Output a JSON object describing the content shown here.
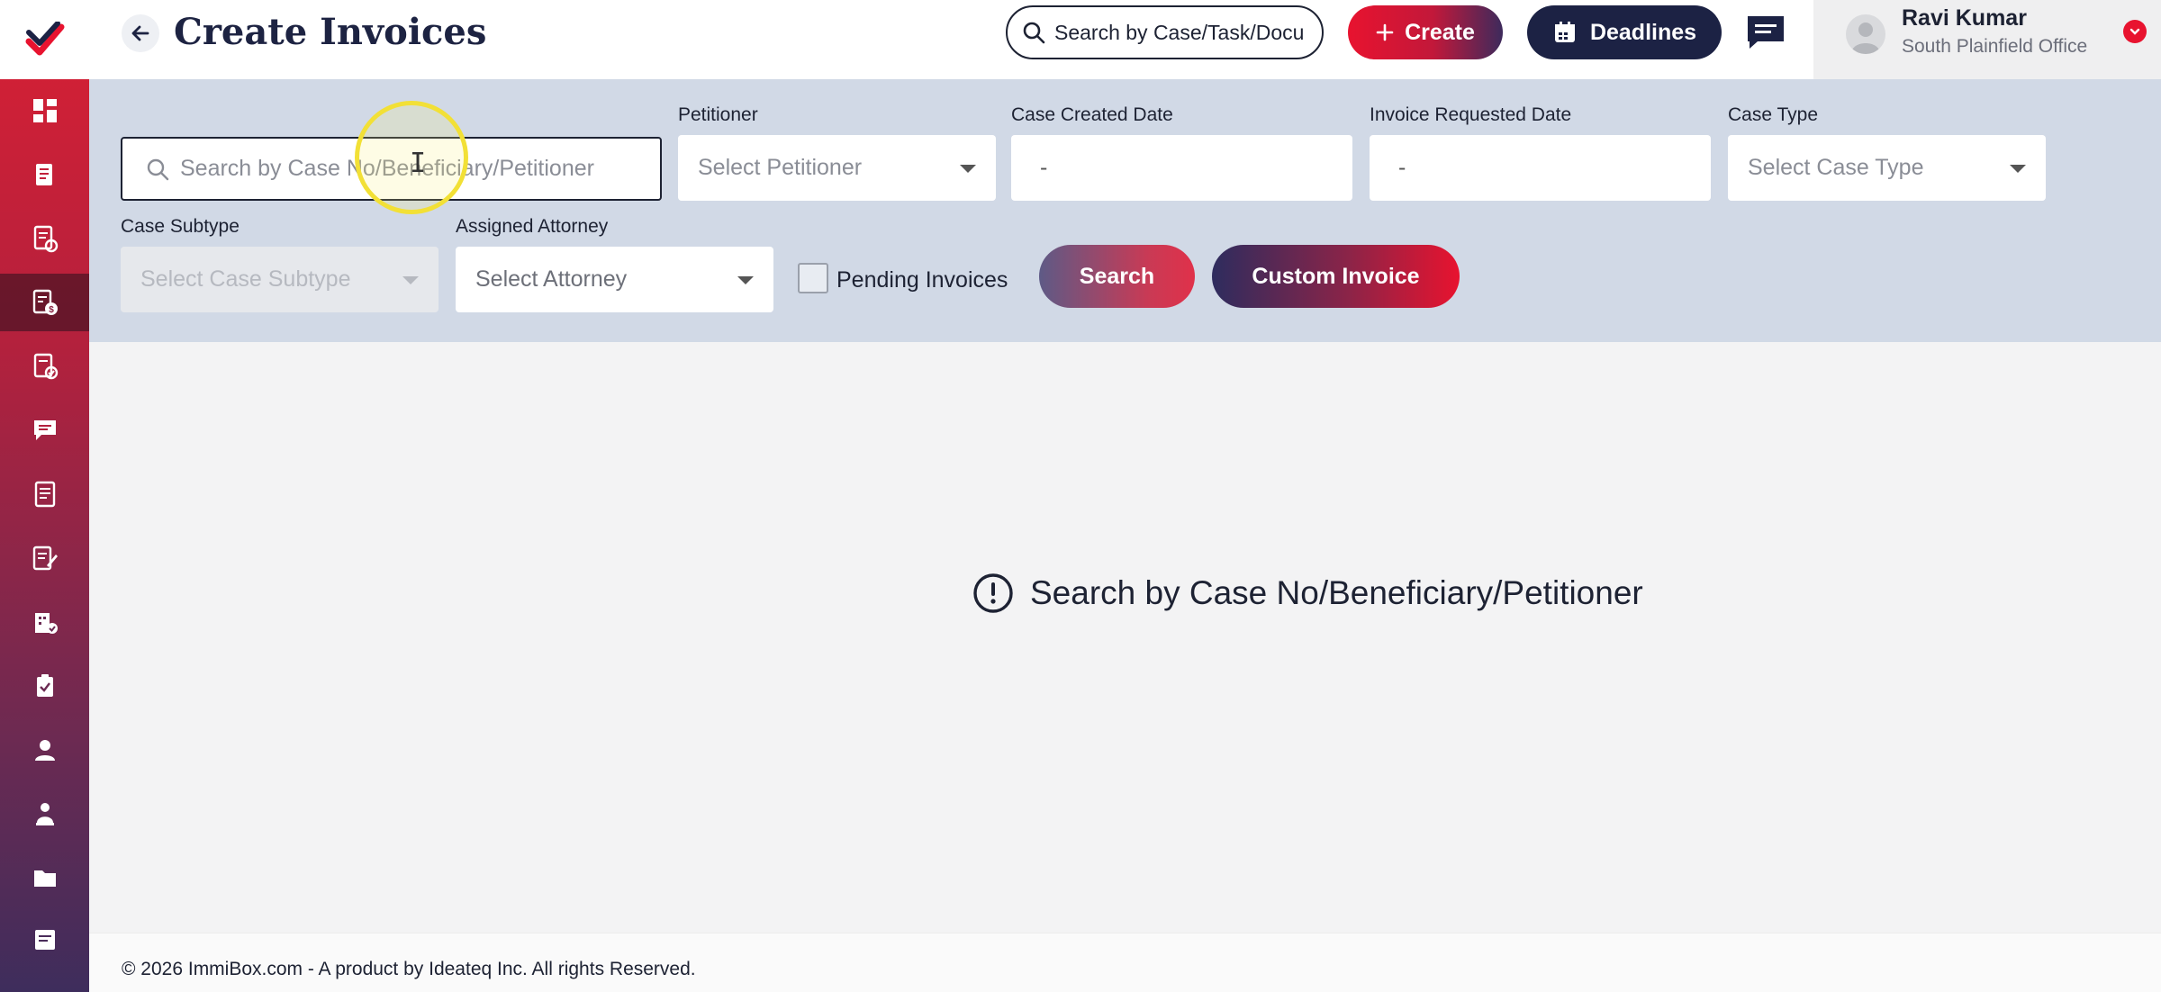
{
  "header": {
    "title": "Create Invoices",
    "global_search_text": "Search by Case/Task/Docu",
    "create_label": "Create",
    "deadlines_label": "Deadlines"
  },
  "user": {
    "name": "Ravi Kumar",
    "office": "South Plainfield Office"
  },
  "sidebar": {
    "items": [
      {
        "name": "dashboard-icon"
      },
      {
        "name": "cases-icon"
      },
      {
        "name": "documents-check-icon"
      },
      {
        "name": "invoice-icon",
        "active": true
      },
      {
        "name": "approved-docs-icon"
      },
      {
        "name": "messages-icon"
      },
      {
        "name": "book-icon"
      },
      {
        "name": "edit-list-icon"
      },
      {
        "name": "building-check-icon"
      },
      {
        "name": "clipboard-icon"
      },
      {
        "name": "user-icon"
      },
      {
        "name": "users-icon"
      },
      {
        "name": "folder-icon"
      },
      {
        "name": "notes-icon"
      }
    ]
  },
  "filters": {
    "case_search_placeholder": "Search by Case No/Beneficiary/Petitioner",
    "petitioner_label": "Petitioner",
    "petitioner_placeholder": "Select Petitioner",
    "case_created_label": "Case Created Date",
    "case_created_value": "-",
    "invoice_requested_label": "Invoice Requested Date",
    "invoice_requested_value": "-",
    "case_type_label": "Case Type",
    "case_type_placeholder": "Select Case Type",
    "case_subtype_label": "Case Subtype",
    "case_subtype_placeholder": "Select Case Subtype",
    "attorney_label": "Assigned Attorney",
    "attorney_placeholder": "Select Attorney",
    "pending_label": "Pending Invoices",
    "search_label": "Search",
    "custom_invoice_label": "Custom Invoice"
  },
  "empty_state": {
    "message": "Search by Case No/Beneficiary/Petitioner"
  },
  "footer": {
    "text": "© 2026 ImmiBox.com - A product by Ideateq Inc. All rights Reserved."
  },
  "colors": {
    "brand_red": "#e8132f",
    "navy": "#1c2244",
    "filter_bg": "#d1d9e6"
  }
}
